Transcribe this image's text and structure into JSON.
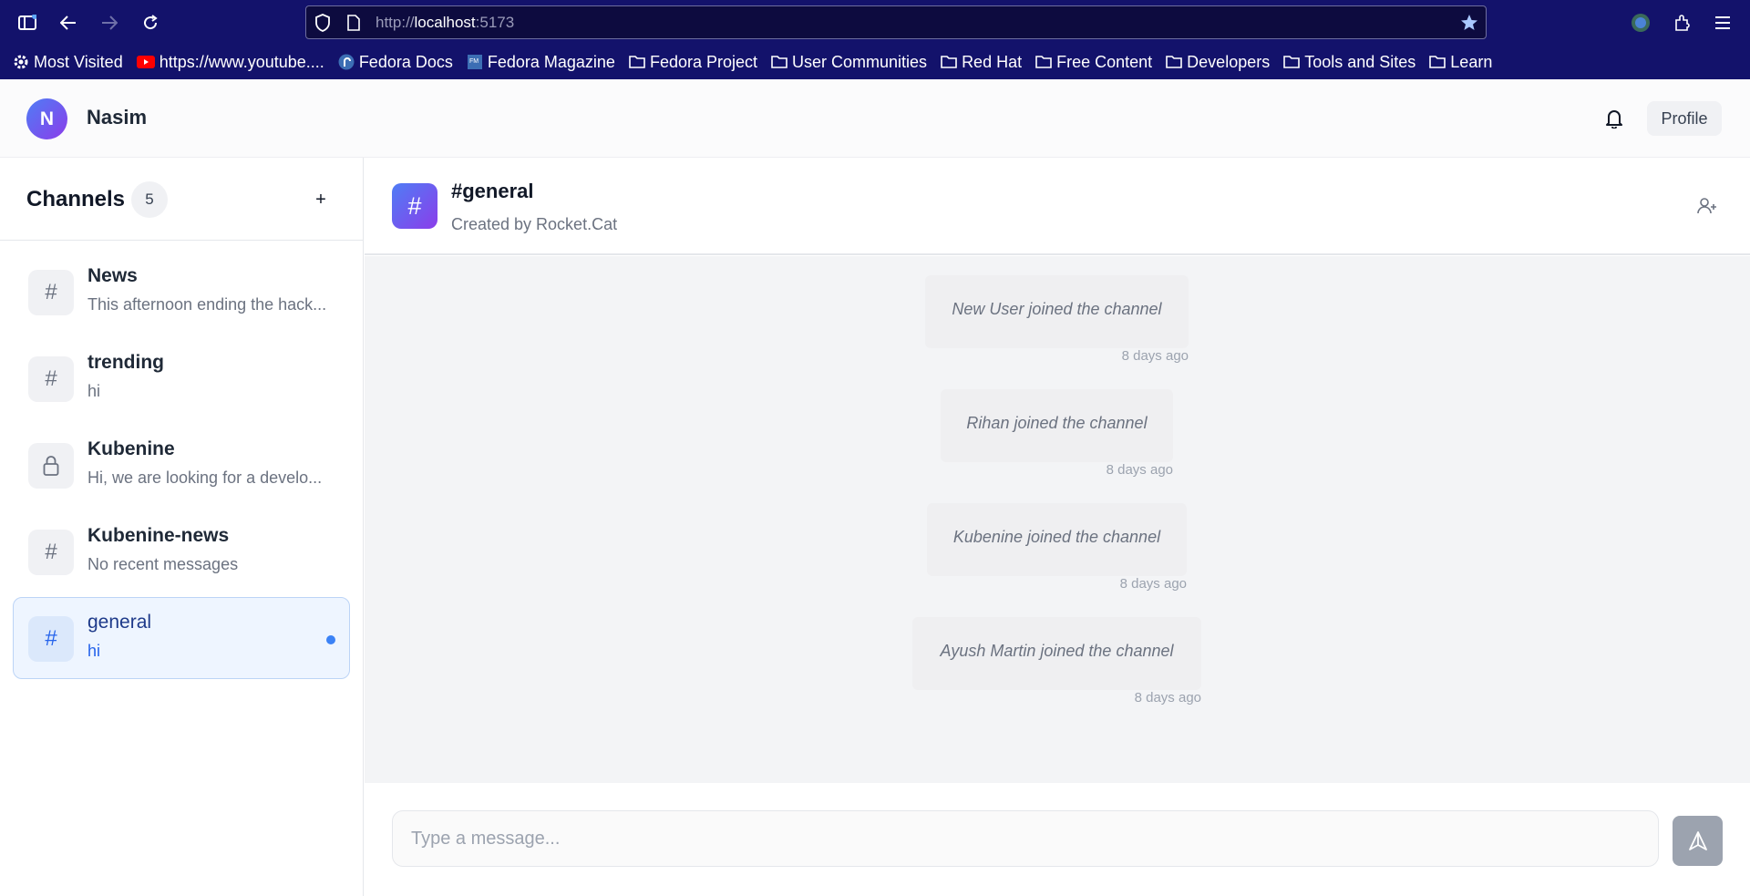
{
  "browser": {
    "url_prefix": "http://",
    "url_host": "localhost",
    "url_port": ":5173",
    "bookmarks": [
      {
        "label": "Most Visited",
        "icon": "gear-icon"
      },
      {
        "label": "https://www.youtube....",
        "icon": "youtube-icon"
      },
      {
        "label": "Fedora Docs",
        "icon": "fedora-icon"
      },
      {
        "label": "Fedora Magazine",
        "icon": "fedora-magazine-icon"
      },
      {
        "label": "Fedora Project",
        "icon": "folder-icon"
      },
      {
        "label": "User Communities",
        "icon": "folder-icon"
      },
      {
        "label": "Red Hat",
        "icon": "folder-icon"
      },
      {
        "label": "Free Content",
        "icon": "folder-icon"
      },
      {
        "label": "Developers",
        "icon": "folder-icon"
      },
      {
        "label": "Tools and Sites",
        "icon": "folder-icon"
      },
      {
        "label": "Learn",
        "icon": "folder-icon"
      }
    ]
  },
  "header": {
    "avatar_initial": "N",
    "user_name": "Nasim",
    "profile_label": "Profile"
  },
  "sidebar": {
    "title": "Channels",
    "count": "5",
    "add_label": "+",
    "channels": [
      {
        "name": "News",
        "preview": "This afternoon ending the hack...",
        "icon": "hash-icon",
        "icon_char": "#",
        "active": false
      },
      {
        "name": "trending",
        "preview": "hi",
        "icon": "hash-icon",
        "icon_char": "#",
        "active": false
      },
      {
        "name": "Kubenine",
        "preview": "Hi, we are looking for a develo...",
        "icon": "lock-icon",
        "icon_char": "",
        "active": false
      },
      {
        "name": "Kubenine-news",
        "preview": "No recent messages",
        "icon": "hash-icon",
        "icon_char": "#",
        "active": false
      },
      {
        "name": "general",
        "preview": "hi",
        "icon": "hash-icon",
        "icon_char": "#",
        "active": true,
        "unread": true
      }
    ]
  },
  "channel": {
    "icon_char": "#",
    "title": "#general",
    "subtitle": "Created by Rocket.Cat"
  },
  "messages": [
    {
      "text": "New User joined the channel",
      "time": "8 days ago"
    },
    {
      "text": "Rihan joined the channel",
      "time": "8 days ago"
    },
    {
      "text": "Kubenine joined the channel",
      "time": "8 days ago"
    },
    {
      "text": "Ayush Martin joined the channel",
      "time": "8 days ago"
    }
  ],
  "composer": {
    "placeholder": "Type a message..."
  },
  "colors": {
    "browser_chrome": "#13126b",
    "accent_gradient_start": "#4f7df5",
    "accent_gradient_end": "#8b3dea",
    "unread_dot": "#3b82f6",
    "active_channel_bg": "#eef5ff"
  }
}
